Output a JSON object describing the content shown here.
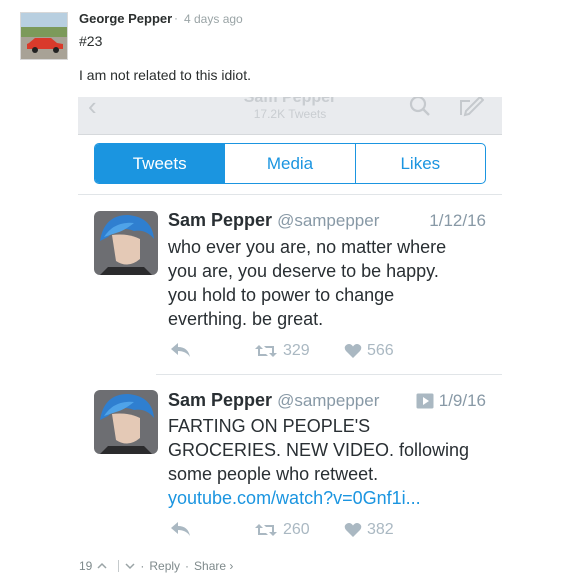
{
  "comment": {
    "author": "George Pepper",
    "separator": "·",
    "time": "4 days ago",
    "number": "#23",
    "body": "I am not related to this idiot."
  },
  "embed": {
    "header": {
      "name": "Sam Pepper",
      "tweets_count": "17.2K Tweets"
    },
    "tabs": [
      "Tweets",
      "Media",
      "Likes"
    ],
    "active_tab": "Tweets",
    "tweets": [
      {
        "name": "Sam Pepper",
        "handle": "@sampepper",
        "date": "1/12/16",
        "lines": [
          "who ever you are, no matter where",
          "you are, you deserve to be happy.",
          "you hold to power to change",
          "everthing. be great."
        ],
        "link": "",
        "retweets": "329",
        "likes": "566",
        "has_video_icon": false
      },
      {
        "name": "Sam Pepper",
        "handle": "@sampepper",
        "date": "1/9/16",
        "lines": [
          "FARTING ON PEOPLE'S",
          "GROCERIES. NEW VIDEO. following",
          "some people who retweet."
        ],
        "link": "youtube.com/watch?v=0Gnf1i...",
        "retweets": "260",
        "likes": "382",
        "has_video_icon": true
      }
    ]
  },
  "footer": {
    "votes": "19",
    "upvote_icon": "chevron-up-icon",
    "downvote_icon": "chevron-down-icon",
    "reply": "Reply",
    "share": "Share ›",
    "dot": "·"
  },
  "colors": {
    "twitter_blue": "#1b95e0",
    "muted": "#8899a6",
    "text": "#292f33"
  }
}
